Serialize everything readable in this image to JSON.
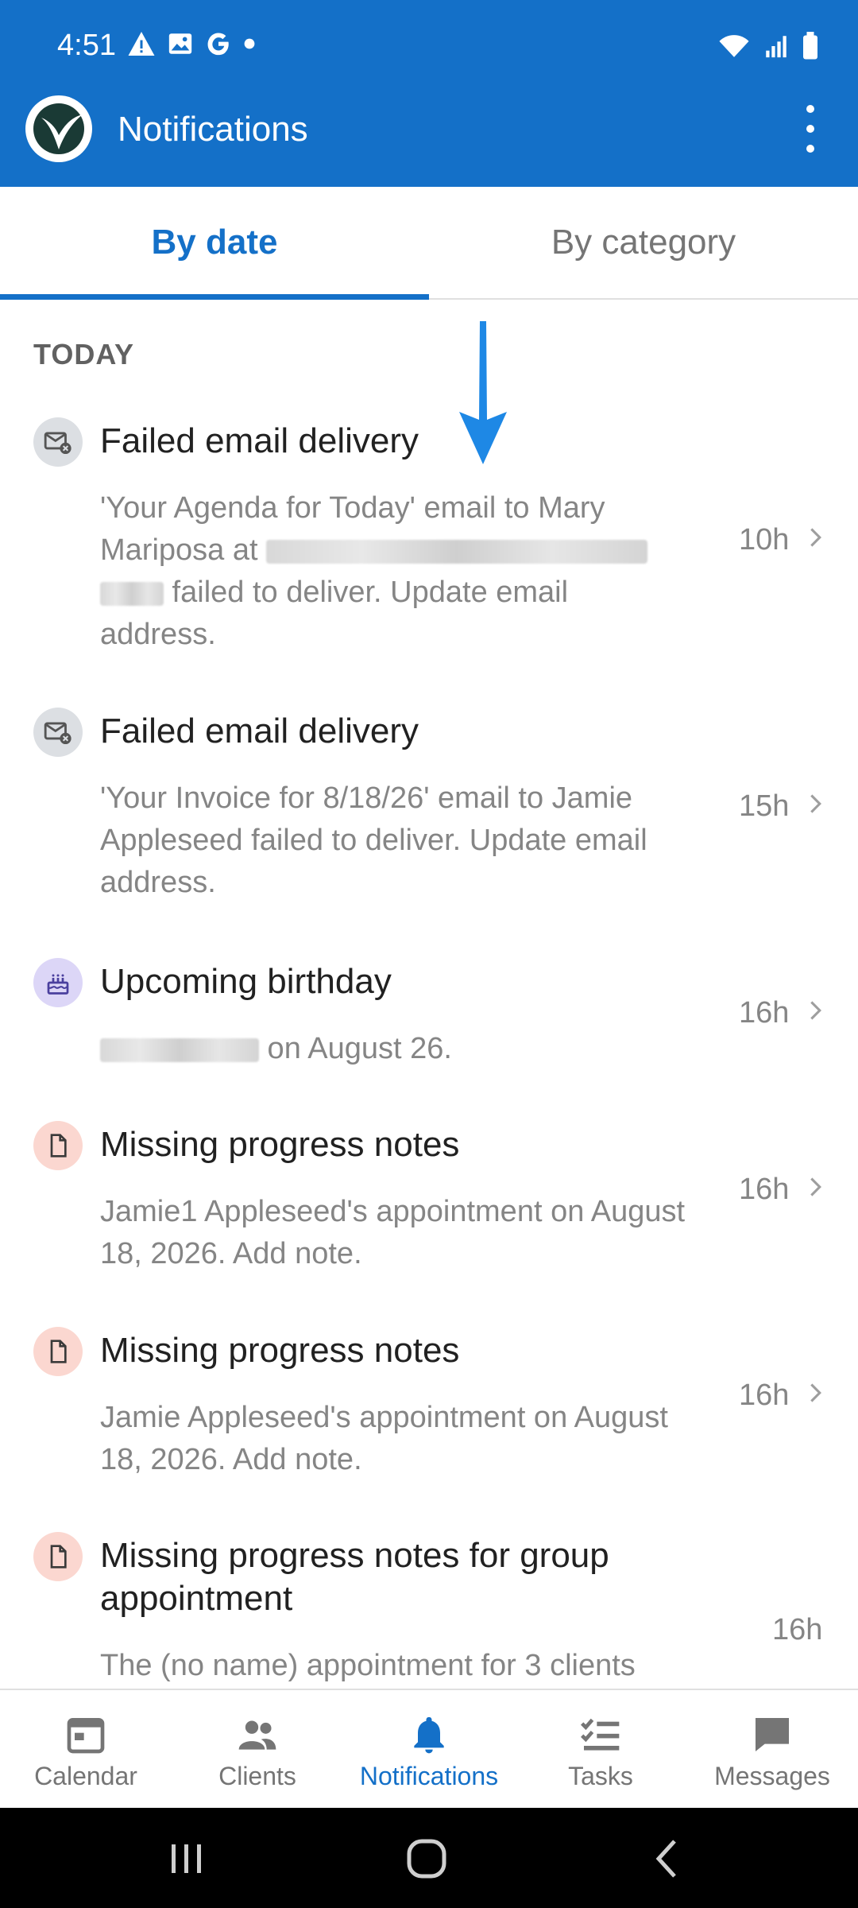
{
  "status": {
    "time": "4:51",
    "left_icons": [
      "warning-icon",
      "image-icon",
      "google-icon",
      "dot-icon"
    ],
    "right_icons": [
      "wifi-icon",
      "signal-icon",
      "battery-icon"
    ]
  },
  "appbar": {
    "title": "Notifications"
  },
  "tabs": [
    {
      "label": "By date",
      "active": true
    },
    {
      "label": "By category",
      "active": false
    }
  ],
  "section": {
    "title": "TODAY"
  },
  "items": [
    {
      "icon": "email-failed-icon",
      "title": "Failed email delivery",
      "body_parts": [
        "'Your Agenda for Today' email to Mary Mariposa at ",
        " failed to deliver. Update email address."
      ],
      "time": "10h"
    },
    {
      "icon": "email-failed-icon",
      "title": "Failed email delivery",
      "body": "'Your Invoice for 8/18/26' email to Jamie Appleseed failed to deliver. Update email address.",
      "time": "15h"
    },
    {
      "icon": "cake-icon",
      "title": "Upcoming birthday",
      "body_suffix": " on August 26.",
      "time": "16h"
    },
    {
      "icon": "document-icon",
      "title": "Missing progress notes",
      "body": "Jamie1 Appleseed's appointment on August 18, 2026. Add note.",
      "time": "16h"
    },
    {
      "icon": "document-icon",
      "title": "Missing progress notes",
      "body": "Jamie Appleseed's appointment on August 18, 2026. Add note.",
      "time": "16h"
    },
    {
      "icon": "document-icon",
      "title": "Missing progress notes for group appointment",
      "body": "The (no name) appointment for 3 clients",
      "time": "16h"
    }
  ],
  "bottom_nav": [
    {
      "label": "Calendar",
      "icon": "calendar-icon",
      "active": false
    },
    {
      "label": "Clients",
      "icon": "clients-icon",
      "active": false
    },
    {
      "label": "Notifications",
      "icon": "bell-icon",
      "active": true
    },
    {
      "label": "Tasks",
      "icon": "tasks-icon",
      "active": false
    },
    {
      "label": "Messages",
      "icon": "message-icon",
      "active": false
    }
  ],
  "colors": {
    "primary": "#1470c8",
    "arrow": "#1e88e5"
  }
}
